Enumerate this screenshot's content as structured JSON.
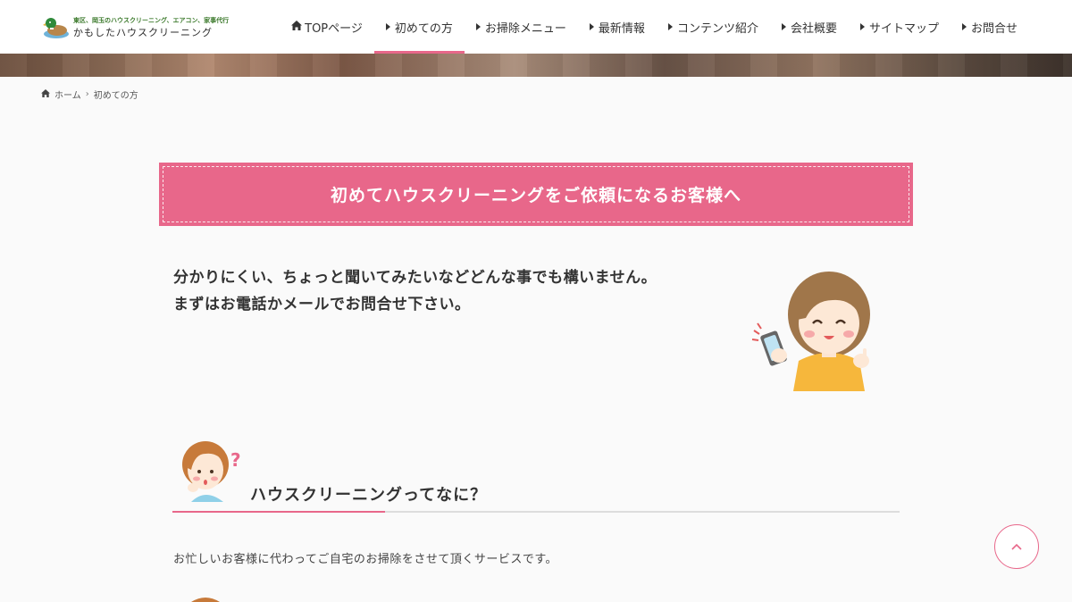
{
  "header": {
    "logo": {
      "tagline": "東区、岡玉のハウスクリーニング、エアコン、家事代行",
      "name": "かもしたハウスクリーニング"
    },
    "nav": [
      {
        "label": "TOPページ",
        "icon": "home-icon",
        "active": false
      },
      {
        "label": "初めての方",
        "icon": "caret-right-icon",
        "active": true
      },
      {
        "label": "お掃除メニュー",
        "icon": "caret-right-icon",
        "active": false
      },
      {
        "label": "最新情報",
        "icon": "caret-right-icon",
        "active": false
      },
      {
        "label": "コンテンツ紹介",
        "icon": "caret-right-icon",
        "active": false
      },
      {
        "label": "会社概要",
        "icon": "caret-right-icon",
        "active": false
      },
      {
        "label": "サイトマップ",
        "icon": "caret-right-icon",
        "active": false
      },
      {
        "label": "お問合せ",
        "icon": "caret-right-icon",
        "active": false
      }
    ]
  },
  "breadcrumb": {
    "home": "ホーム",
    "current": "初めての方"
  },
  "banner": {
    "title": "初めてハウスクリーニングをご依頼になるお客様へ"
  },
  "intro": {
    "line1": "分かりにくい、ちょっと聞いてみたいなどどんな事でも構いません。",
    "line2": "まずはお電話かメールでお問合せ下さい。"
  },
  "section": {
    "heading": "ハウスクリーニングってなに？",
    "text": "お忙しいお客様に代わってご自宅のお掃除をさせて頂くサービスです。"
  },
  "colors": {
    "accent": "#e8678a",
    "text": "#333333",
    "background": "#fafafa"
  }
}
